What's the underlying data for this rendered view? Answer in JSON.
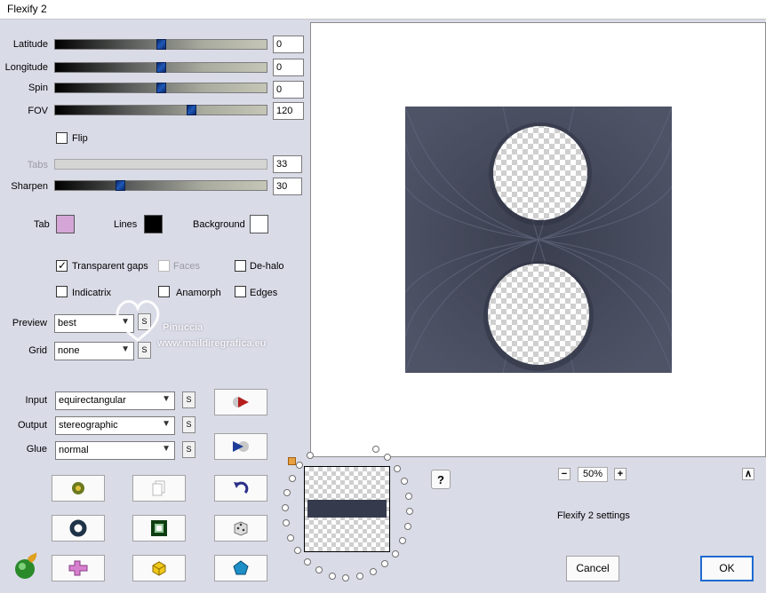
{
  "window": {
    "title": "Flexify 2"
  },
  "sliders": [
    {
      "label": "Latitude",
      "value": "0",
      "fraction": 0.5,
      "disabled": false
    },
    {
      "label": "Longitude",
      "value": "0",
      "fraction": 0.5,
      "disabled": false
    },
    {
      "label": "Spin",
      "value": "0",
      "fraction": 0.5,
      "disabled": false
    },
    {
      "label": "FOV",
      "value": "120",
      "fraction": 0.65,
      "disabled": false
    }
  ],
  "flip": {
    "label": "Flip",
    "checked": false
  },
  "tabs_slider": {
    "label": "Tabs",
    "value": "33",
    "disabled": true
  },
  "sharpen_slider": {
    "label": "Sharpen",
    "value": "30",
    "fraction": 0.3
  },
  "colors": {
    "tab": {
      "label": "Tab",
      "color": "#d4a6d8"
    },
    "lines": {
      "label": "Lines",
      "color": "#000000"
    },
    "background": {
      "label": "Background",
      "color": "#ffffff"
    }
  },
  "options": {
    "transparent_gaps": {
      "label": "Transparent gaps",
      "checked": true,
      "disabled": false
    },
    "faces": {
      "label": "Faces",
      "checked": false,
      "disabled": true
    },
    "de_halo": {
      "label": "De-halo",
      "checked": false,
      "disabled": false
    },
    "indicatrix": {
      "label": "Indicatrix",
      "checked": false,
      "disabled": false
    },
    "anamorph": {
      "label": "Anamorph",
      "checked": false,
      "disabled": false
    },
    "edges": {
      "label": "Edges",
      "checked": false,
      "disabled": false
    }
  },
  "preview_select": {
    "label": "Preview",
    "value": "best",
    "s": "S"
  },
  "grid_select": {
    "label": "Grid",
    "value": "none",
    "s": "S"
  },
  "input_select": {
    "label": "Input",
    "value": "equirectangular",
    "s": "S"
  },
  "output_select": {
    "label": "Output",
    "value": "stereographic",
    "s": "S"
  },
  "glue_select": {
    "label": "Glue",
    "value": "normal",
    "s": "S"
  },
  "watermark": {
    "line1": "Pinuccia",
    "line2": "www.maildiregrafica.eu"
  },
  "zoom": {
    "minus": "−",
    "value": "50%",
    "plus": "+"
  },
  "collapse_label": "∧",
  "help_label": "?",
  "settings_name": "Flexify 2 settings",
  "buttons": {
    "cancel": "Cancel",
    "ok": "OK"
  },
  "accent": {
    "preview_fill": "#3a3e4e",
    "thumb": "#1f58b8",
    "thumb_bar": "#363a4d"
  }
}
